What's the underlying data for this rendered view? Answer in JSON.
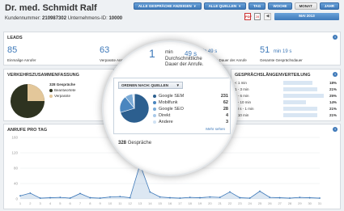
{
  "header": {
    "title": "Dr. med. Schmidt Ralf",
    "customer_label": "Kundennummer:",
    "customer_number": "210987302",
    "company_label": "Unternehmens-ID:",
    "company_id": "10000"
  },
  "toolbar": {
    "all_calls": "ALLE GESPRÄCHE ANZEIGEN",
    "all_sources": "ALLE QUELLEN",
    "day": "TAG",
    "week": "WOCHE",
    "month": "MONAT",
    "year": "JAHR",
    "period": "MAI 2013",
    "pdf_label": "PDF",
    "calendar_label": "28"
  },
  "leads": {
    "title": "LEADS",
    "items": [
      {
        "value": "85",
        "unit": "",
        "label": "Einmalige Anrufer"
      },
      {
        "value": "63",
        "unit": "",
        "label": "Verpasste Anrufe"
      },
      {
        "value": "1",
        "unit": "min 49 s",
        "label": "Durchschnittliche Dauer der Anrufe"
      },
      {
        "value": "51",
        "unit": "min 19 s",
        "label": "Gesamte Gesprächsdauer"
      }
    ]
  },
  "verkehr": {
    "title": "VERKEHRSZUSAMMENFASSUNG",
    "total": "328 Gespräche",
    "answered": "Beantwortete",
    "missed": "Verpasste"
  },
  "dauer": {
    "title": "GESPRÄCHSLÄNGENVERTEILUNG",
    "rows": [
      {
        "label": "< 1 min",
        "pct": "18%",
        "frac": 0.18
      },
      {
        "label": "1 - 3 min",
        "pct": "21%",
        "frac": 0.21
      },
      {
        "label": "3 - 6 min",
        "pct": "25%",
        "frac": 0.25
      },
      {
        "label": "6 - 10 min",
        "pct": "14%",
        "frac": 0.14
      },
      {
        "label": "10 s - 1 min",
        "pct": "21%",
        "frac": 0.21
      },
      {
        "label": "> 10 min",
        "pct": "21%",
        "frac": 0.21
      }
    ]
  },
  "magnifier": {
    "stat_value": "1",
    "stat_unit_min": "min",
    "stat_sec": "49 s",
    "stat_caption": "Durchschnittliche Dauer der Anrufe.",
    "select_label": "ORDNEN NACH: QUELLEN",
    "more_link": "Mehr sehen",
    "sub_total": "328",
    "sub_label": "Gespräche",
    "sources": [
      {
        "name": "Google SEM",
        "value": "231",
        "color": "#2c5f8f"
      },
      {
        "name": "Mobilfunk",
        "value": "62",
        "color": "#4a86bf"
      },
      {
        "name": "Google SEO",
        "value": "28",
        "color": "#7aaad6"
      },
      {
        "name": "Direkt",
        "value": "4",
        "color": "#a9c9e8"
      },
      {
        "name": "Andere",
        "value": "3",
        "color": "#d0e2f3"
      }
    ]
  },
  "anrufe": {
    "title": "ANRUFE PRO TAG"
  },
  "chart_data": {
    "type": "area",
    "title": "ANRUFE PRO TAG",
    "xlabel": "",
    "ylabel": "",
    "ylim": [
      0,
      160
    ],
    "yticks": [
      0,
      40,
      80,
      120,
      160
    ],
    "x": [
      1,
      2,
      3,
      4,
      5,
      6,
      7,
      8,
      9,
      10,
      11,
      12,
      13,
      14,
      15,
      16,
      17,
      18,
      19,
      20,
      21,
      22,
      23,
      24,
      25,
      26,
      27,
      28,
      29,
      30,
      31
    ],
    "values": [
      8,
      15,
      2,
      3,
      4,
      2,
      14,
      3,
      2,
      5,
      6,
      3,
      90,
      18,
      5,
      3,
      2,
      4,
      3,
      5,
      4,
      18,
      3,
      2,
      20,
      4,
      3,
      2,
      4,
      3,
      2
    ],
    "color": "#3e79b9"
  }
}
